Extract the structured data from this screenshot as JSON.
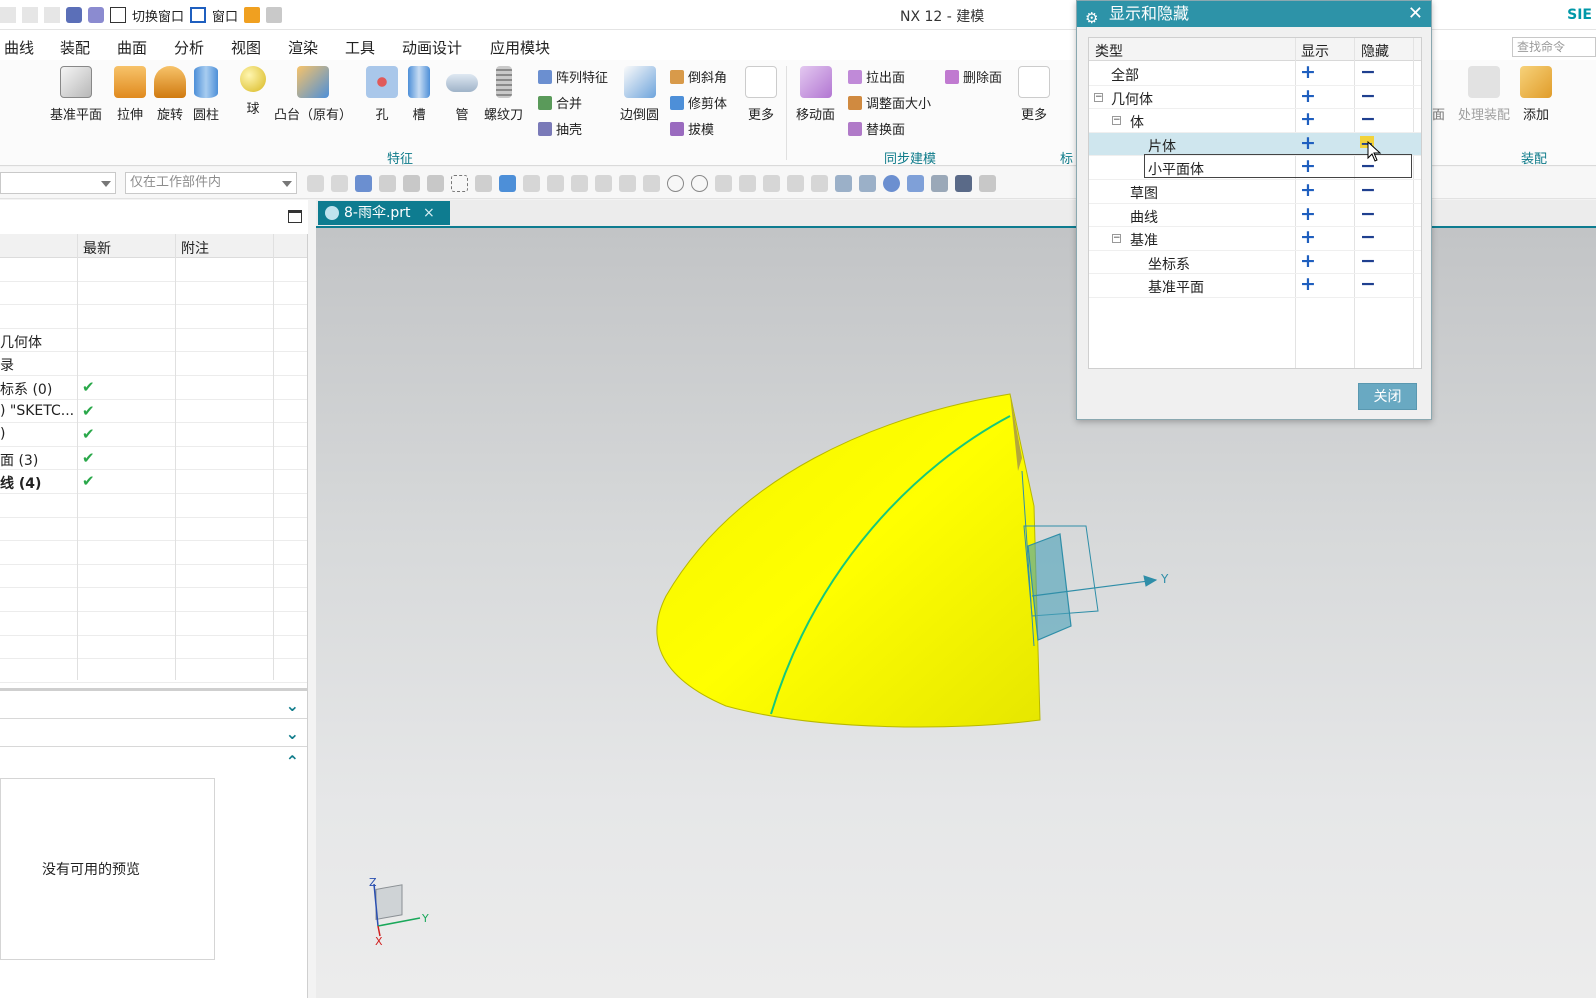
{
  "window": {
    "title": "NX 12 - 建模",
    "brand": "SIE"
  },
  "quick_access": {
    "switch_window": "切换窗口",
    "window": "窗口"
  },
  "menu": [
    "曲线",
    "装配",
    "曲面",
    "分析",
    "视图",
    "渲染",
    "工具",
    "动画设计",
    "应用模块"
  ],
  "search_placeholder": "查找命令",
  "ribbon": {
    "feature_buttons": [
      "基准平面",
      "拉伸",
      "旋转",
      "圆柱",
      "球",
      "凸台（原有）",
      "孔",
      "槽",
      "管",
      "螺纹刀"
    ],
    "feature_small": [
      "阵列特征",
      "合并",
      "抽壳"
    ],
    "edge_blend": "边倒圆",
    "feature_small2": [
      "倒斜角",
      "修剪体",
      "拔模"
    ],
    "more1": "更多",
    "group_feature": "特征",
    "move_face": "移动面",
    "sync_small": [
      "拉出面",
      "调整面大小",
      "替换面"
    ],
    "delete_face": "删除面",
    "more2": "更多",
    "group_sync": "同步建模",
    "group_cut": "标",
    "face_cut": "面",
    "process_assembly": "处理装配",
    "add": "添加",
    "group_assembly": "装配"
  },
  "selection_bar": {
    "scope": "仅在工作部件内"
  },
  "navigator": {
    "headers": [
      "最新",
      "附注"
    ],
    "rows": [
      {
        "name": "",
        "latest": ""
      },
      {
        "name": "",
        "latest": ""
      },
      {
        "name": "",
        "latest": ""
      },
      {
        "name": "几何体",
        "latest": ""
      },
      {
        "name": "录",
        "latest": ""
      },
      {
        "name": "标系 (0)",
        "latest": "✔"
      },
      {
        "name": ") \"SKETC...",
        "latest": "✔"
      },
      {
        "name": ")",
        "latest": "✔"
      },
      {
        "name": "面 (3)",
        "latest": "✔"
      },
      {
        "name": "线 (4)",
        "latest": "✔"
      },
      {
        "name": "",
        "latest": ""
      },
      {
        "name": "",
        "latest": ""
      },
      {
        "name": "",
        "latest": ""
      },
      {
        "name": "",
        "latest": ""
      },
      {
        "name": "",
        "latest": ""
      },
      {
        "name": "",
        "latest": ""
      },
      {
        "name": "",
        "latest": ""
      },
      {
        "name": "",
        "latest": ""
      }
    ],
    "preview_text": "没有可用的预览"
  },
  "document_tab": "8-雨伞.prt",
  "view_triad": {
    "x": "X",
    "y": "Y",
    "z": "Z"
  },
  "csys_label": "Y",
  "dialog": {
    "title": "显示和隐藏",
    "headers": {
      "type": "类型",
      "show": "显示",
      "hide": "隐藏"
    },
    "rows": [
      {
        "label": "全部",
        "indent": 0,
        "expander": ""
      },
      {
        "label": "几何体",
        "indent": 0,
        "expander": "−"
      },
      {
        "label": "体",
        "indent": 1,
        "expander": "−"
      },
      {
        "label": "片体",
        "indent": 2,
        "expander": "",
        "selected": true
      },
      {
        "label": "小平面体",
        "indent": 2,
        "expander": ""
      },
      {
        "label": "草图",
        "indent": 1,
        "expander": ""
      },
      {
        "label": "曲线",
        "indent": 1,
        "expander": ""
      },
      {
        "label": "基准",
        "indent": 1,
        "expander": "−"
      },
      {
        "label": "坐标系",
        "indent": 2,
        "expander": ""
      },
      {
        "label": "基准平面",
        "indent": 2,
        "expander": ""
      }
    ],
    "show_symbol": "+",
    "hide_symbol": "−",
    "close_label": "关闭"
  },
  "colors": {
    "accent": "#2d93a8",
    "tab": "#0e7c90",
    "model": "#ffff00",
    "check": "#2aa84a"
  }
}
